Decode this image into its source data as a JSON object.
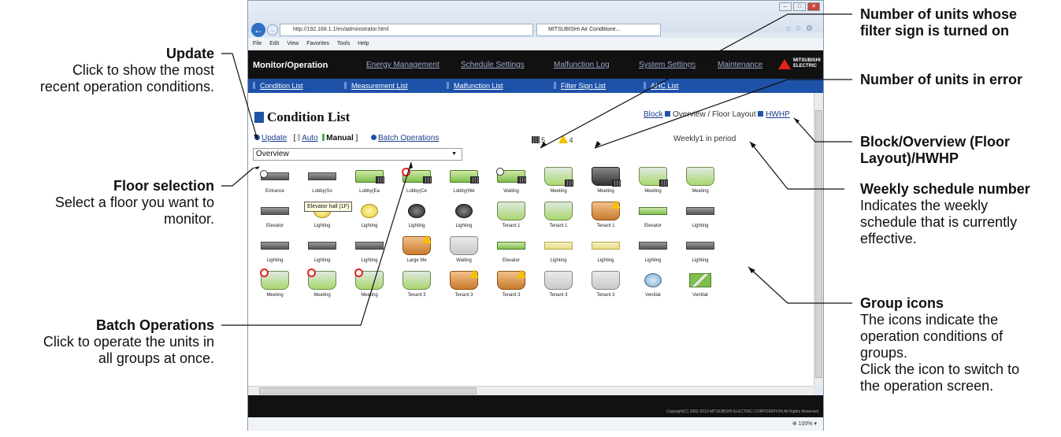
{
  "browser": {
    "url": "http://192.168.1.1/en/administrator.html",
    "tab_title": "MITSUBISHI Air Conditione...",
    "menu": [
      "File",
      "Edit",
      "View",
      "Favorites",
      "Tools",
      "Help"
    ],
    "zoom": "100%"
  },
  "app": {
    "main_nav": [
      {
        "label": "Monitor/Operation",
        "active": true
      },
      {
        "label": "Energy Management",
        "active": false
      },
      {
        "label": "Schedule Settings",
        "active": false
      },
      {
        "label": "Malfunction Log",
        "active": false
      },
      {
        "label": "System Settings",
        "active": false
      },
      {
        "label": "Maintenance",
        "active": false
      }
    ],
    "logo_text": "MITSUBISHI ELECTRIC",
    "sub_nav": [
      "Condition List",
      "Measurement List",
      "Malfunction List",
      "Filter Sign List",
      "AHC List"
    ],
    "page_title": "Condition List",
    "update_label": "Update",
    "mode_auto": "Auto",
    "mode_manual": "Manual",
    "batch_label": "Batch Operations",
    "filter_count": "5",
    "error_count": "4",
    "view_block": "Block",
    "view_overview": "Overview / Floor Layout",
    "view_hwhp": "HWHP",
    "weekly": "Weekly1 in period",
    "floor_value": "Overview",
    "tooltip": "Elevator hall (1F)",
    "copyright": "Copyright(C) 2002-2013 MITSUBISHI ELECTRIC CORPORATION All Rights Reserved",
    "groups": [
      {
        "label": "Entrance",
        "icon": "wall-unit",
        "badge": "timer"
      },
      {
        "label": "Lobby(So",
        "icon": "wall-unit",
        "badge": ""
      },
      {
        "label": "Lobby(Ea",
        "icon": "ceiling-unit",
        "badge": "filter"
      },
      {
        "label": "Lobby(Ce",
        "icon": "ceiling-unit",
        "badge": "prohibit-filter"
      },
      {
        "label": "Lobby(We",
        "icon": "ceiling-unit",
        "badge": "filter"
      },
      {
        "label": "Waiting",
        "icon": "ceiling-unit",
        "badge": "timer-filter"
      },
      {
        "label": "Meeting",
        "icon": "cassette",
        "badge": "filter"
      },
      {
        "label": "Meeting",
        "icon": "cassette-dark",
        "badge": "filter"
      },
      {
        "label": "Meeting",
        "icon": "cassette",
        "badge": "filter"
      },
      {
        "label": "Meeting",
        "icon": "cassette",
        "badge": ""
      },
      {
        "label": "Elevator",
        "icon": "wall-unit",
        "badge": ""
      },
      {
        "label": "Lighting",
        "icon": "light",
        "badge": ""
      },
      {
        "label": "Lighting",
        "icon": "light",
        "badge": ""
      },
      {
        "label": "Lighting",
        "icon": "light-dark",
        "badge": ""
      },
      {
        "label": "Lighting",
        "icon": "light-dark",
        "badge": ""
      },
      {
        "label": "Tenant 1",
        "icon": "cassette",
        "badge": ""
      },
      {
        "label": "Tenant 1",
        "icon": "cassette",
        "badge": ""
      },
      {
        "label": "Tenant 1",
        "icon": "cassette-brown",
        "badge": "warning"
      },
      {
        "label": "Elevator",
        "icon": "wall-green",
        "badge": ""
      },
      {
        "label": "Lighting",
        "icon": "wall-unit",
        "badge": ""
      },
      {
        "label": "Lighting",
        "icon": "wall-unit",
        "badge": ""
      },
      {
        "label": "Lighting",
        "icon": "wall-unit",
        "badge": ""
      },
      {
        "label": "Lighting",
        "icon": "wall-unit",
        "badge": ""
      },
      {
        "label": "Large Me",
        "icon": "cassette-brown",
        "badge": "warning"
      },
      {
        "label": "Waiting",
        "icon": "cassette-gray",
        "badge": ""
      },
      {
        "label": "Elevator",
        "icon": "wall-green",
        "badge": ""
      },
      {
        "label": "Lighting",
        "icon": "wall-yellow",
        "badge": ""
      },
      {
        "label": "Lighting",
        "icon": "wall-yellow",
        "badge": ""
      },
      {
        "label": "Lighting",
        "icon": "wall-unit",
        "badge": ""
      },
      {
        "label": "Lighting",
        "icon": "wall-unit",
        "badge": ""
      },
      {
        "label": "Meeting",
        "icon": "cassette",
        "badge": "prohibit"
      },
      {
        "label": "Meeting",
        "icon": "cassette",
        "badge": "prohibit"
      },
      {
        "label": "Meeting",
        "icon": "cassette",
        "badge": "prohibit"
      },
      {
        "label": "Tenant 3",
        "icon": "cassette",
        "badge": ""
      },
      {
        "label": "Tenant 3",
        "icon": "cassette-brown",
        "badge": "warning"
      },
      {
        "label": "Tenant 3",
        "icon": "cassette-brown",
        "badge": "warning"
      },
      {
        "label": "Tenant 3",
        "icon": "cassette-gray",
        "badge": ""
      },
      {
        "label": "Tenant 3",
        "icon": "cassette-gray",
        "badge": ""
      },
      {
        "label": "Ventilat",
        "icon": "light-blue",
        "badge": ""
      },
      {
        "label": "Ventilat",
        "icon": "vent",
        "badge": ""
      }
    ]
  },
  "annotations": {
    "update_title": "Update",
    "update_desc1": "Click to show the most",
    "update_desc2": "recent operation conditions.",
    "floor_title": "Floor selection",
    "floor_desc1": "Select a floor you want to",
    "floor_desc2": "monitor.",
    "batch_title": "Batch Operations",
    "batch_desc1": "Click to operate the units in",
    "batch_desc2": "all groups at once.",
    "filter_title1": "Number of units whose",
    "filter_title2": "filter sign is turned on",
    "error_title": "Number of units in error",
    "block_title1": "Block/Overview (Floor",
    "block_title2": "Layout)/HWHP",
    "weekly_title": "Weekly schedule number",
    "weekly_desc1": "Indicates the weekly",
    "weekly_desc2": "schedule that is currently",
    "weekly_desc3": "effective.",
    "group_title": "Group icons",
    "group_desc1": "The icons indicate the",
    "group_desc2": "operation conditions of",
    "group_desc3": "groups.",
    "group_desc4": "Click the icon to switch to",
    "group_desc5": "the operation screen."
  }
}
